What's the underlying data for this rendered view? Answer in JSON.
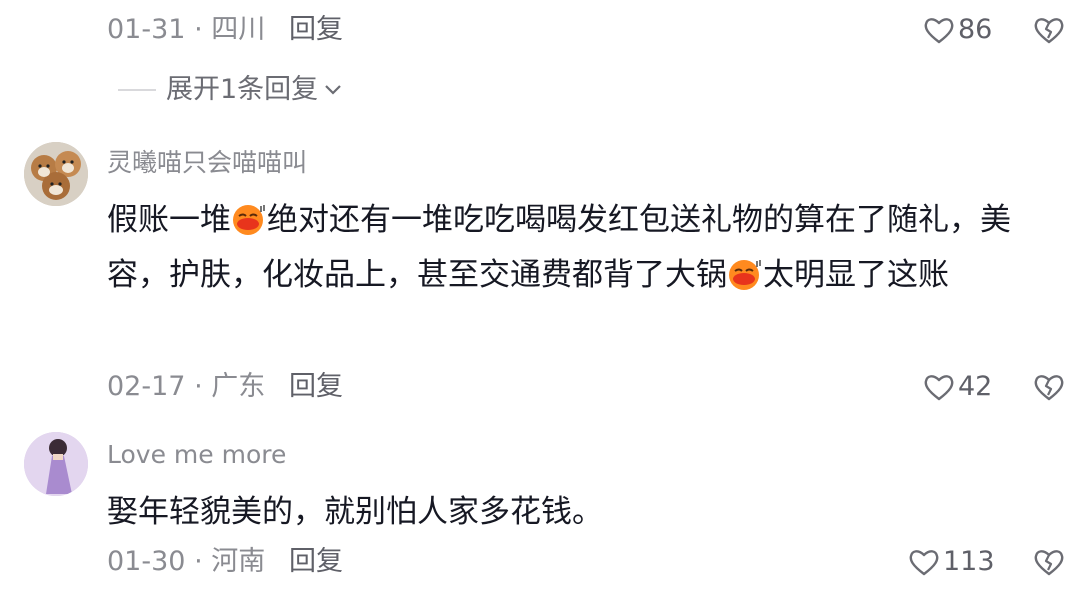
{
  "comments": [
    {
      "date": "01-31",
      "location": "四川",
      "reply_label": "回复",
      "likes": "86",
      "expand_label": "展开1条回复"
    },
    {
      "username": "灵曦喵只会喵喵叫",
      "text_parts": [
        "假账一堆",
        "绝对还有一堆吃吃喝喝发红包送礼物的算在了随礼，美容，护肤，化妆品上，甚至交通费都背了大锅",
        "太明显了这账"
      ],
      "date": "02-17",
      "location": "广东",
      "reply_label": "回复",
      "likes": "42"
    },
    {
      "username": "Love me more",
      "text": "娶年轻貌美的，就别怕人家多花钱。",
      "date": "01-30",
      "location": "河南",
      "reply_label": "回复",
      "likes": "113"
    }
  ],
  "icons": {
    "like": "heart-outline-icon",
    "dislike": "broken-heart-outline-icon",
    "expand": "chevron-down-icon",
    "emoji": "crying-face-emoji"
  },
  "colors": {
    "meta": "#8a8b91",
    "text": "#161823",
    "emoji": "#ff7a1a"
  }
}
